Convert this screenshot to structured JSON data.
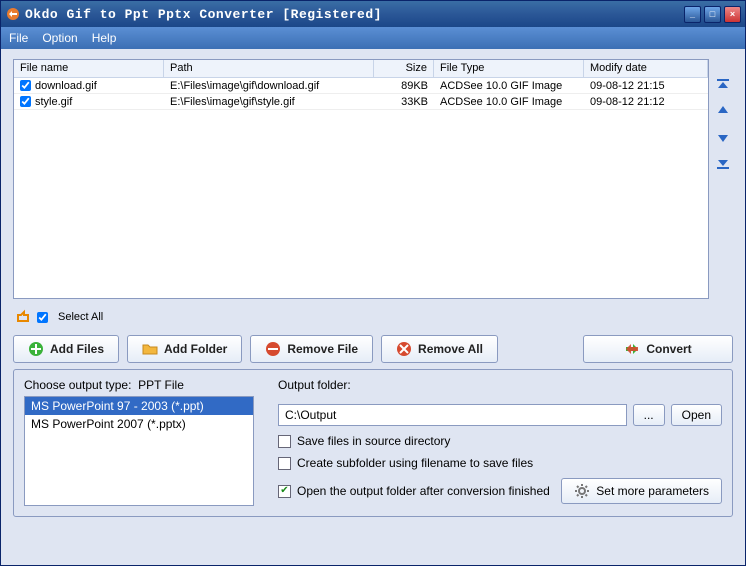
{
  "titlebar": {
    "title": "Okdo Gif to Ppt Pptx Converter [Registered]"
  },
  "menu": {
    "file": "File",
    "option": "Option",
    "help": "Help"
  },
  "columns": {
    "name": "File name",
    "path": "Path",
    "size": "Size",
    "type": "File Type",
    "date": "Modify date"
  },
  "files": [
    {
      "name": "download.gif",
      "path": "E:\\Files\\image\\gif\\download.gif",
      "size": "89KB",
      "type": "ACDSee 10.0 GIF Image",
      "date": "09-08-12 21:15",
      "checked": true
    },
    {
      "name": "style.gif",
      "path": "E:\\Files\\image\\gif\\style.gif",
      "size": "33KB",
      "type": "ACDSee 10.0 GIF Image",
      "date": "09-08-12 21:12",
      "checked": true
    }
  ],
  "selectall": {
    "label": "Select All",
    "checked": true
  },
  "buttons": {
    "addFiles": "Add Files",
    "addFolder": "Add Folder",
    "removeFile": "Remove File",
    "removeAll": "Remove All",
    "convert": "Convert",
    "browse": "...",
    "open": "Open",
    "setMore": "Set more parameters"
  },
  "outputType": {
    "label": "Choose output type:",
    "current": "PPT File",
    "options": [
      {
        "label": "MS PowerPoint 97 - 2003 (*.ppt)",
        "selected": true
      },
      {
        "label": "MS PowerPoint 2007 (*.pptx)",
        "selected": false
      }
    ]
  },
  "outputFolder": {
    "label": "Output folder:",
    "value": "C:\\Output"
  },
  "options": {
    "saveSource": {
      "label": "Save files in source directory",
      "checked": false
    },
    "subfolder": {
      "label": "Create subfolder using filename to save files",
      "checked": false
    },
    "openAfter": {
      "label": "Open the output folder after conversion finished",
      "checked": true
    }
  }
}
